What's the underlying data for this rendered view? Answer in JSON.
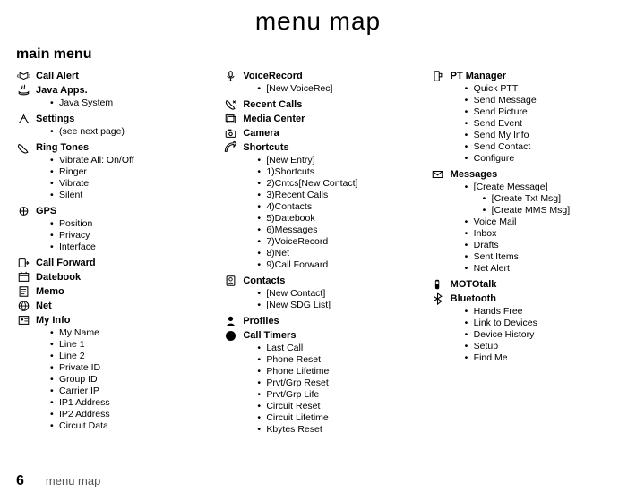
{
  "title": "menu map",
  "section": "main menu",
  "footer": {
    "page": "6",
    "text": "menu map"
  },
  "col1": [
    {
      "label": "Call Alert",
      "icon": "alert"
    },
    {
      "label": "Java Apps.",
      "icon": "java",
      "sub": [
        "Java System"
      ]
    },
    {
      "label": "Settings",
      "icon": "settings",
      "sub": [
        "(see next page)"
      ]
    },
    {
      "label": "Ring Tones",
      "icon": "ring",
      "sub": [
        "Vibrate All: On/Off",
        "Ringer",
        "Vibrate",
        "Silent"
      ]
    },
    {
      "label": "GPS",
      "icon": "gps",
      "sub": [
        "Position",
        "Privacy",
        "Interface"
      ]
    },
    {
      "label": "Call Forward",
      "icon": "forward"
    },
    {
      "label": "Datebook",
      "icon": "datebook"
    },
    {
      "label": "Memo",
      "icon": "memo"
    },
    {
      "label": "Net",
      "icon": "net"
    },
    {
      "label": "My Info",
      "icon": "myinfo",
      "sub": [
        "My Name",
        "Line 1",
        "Line 2",
        "Private ID",
        "Group ID",
        "Carrier IP",
        "IP1 Address",
        "IP2 Address",
        "Circuit Data"
      ]
    }
  ],
  "col2": [
    {
      "label": "VoiceRecord",
      "icon": "voice",
      "sub": [
        "[New VoiceRec]"
      ]
    },
    {
      "label": "Recent Calls",
      "icon": "recent"
    },
    {
      "label": "Media Center",
      "icon": "media"
    },
    {
      "label": "Camera",
      "icon": "camera"
    },
    {
      "label": "Shortcuts",
      "icon": "shortcuts",
      "sub": [
        "[New Entry]",
        "1)Shortcuts",
        "2)Cntcs[New Contact]",
        "3)Recent Calls",
        "4)Contacts",
        "5)Datebook",
        "6)Messages",
        "7)VoiceRecord",
        "8)Net",
        "9)Call Forward"
      ]
    },
    {
      "label": "Contacts",
      "icon": "contacts",
      "sub": [
        "[New Contact]",
        "[New SDG List]"
      ]
    },
    {
      "label": "Profiles",
      "icon": "profiles"
    },
    {
      "label": "Call Timers",
      "icon": "timers",
      "sub": [
        "Last Call",
        "Phone Reset",
        "Phone Lifetime",
        "Prvt/Grp Reset",
        "Prvt/Grp Life",
        "Circuit Reset",
        "Circuit Lifetime",
        "Kbytes Reset"
      ]
    }
  ],
  "col3": [
    {
      "label": "PT Manager",
      "icon": "ptmgr",
      "sub": [
        "Quick PTT",
        "Send Message",
        "Send Picture",
        "Send Event",
        "Send My Info",
        "Send Contact",
        "Configure"
      ]
    },
    {
      "label": "Messages",
      "icon": "messages",
      "sub": [
        {
          "t": "[Create Message]",
          "sub2": [
            "[Create Txt Msg]",
            "[Create MMS Msg]"
          ]
        },
        "Voice Mail",
        "Inbox",
        "Drafts",
        "Sent Items",
        "Net Alert"
      ]
    },
    {
      "label": "MOTOtalk",
      "icon": "mototalk"
    },
    {
      "label": "Bluetooth",
      "icon": "bluetooth",
      "sub": [
        "Hands Free",
        "Link to Devices",
        "Device History",
        "Setup",
        "Find Me"
      ]
    }
  ]
}
